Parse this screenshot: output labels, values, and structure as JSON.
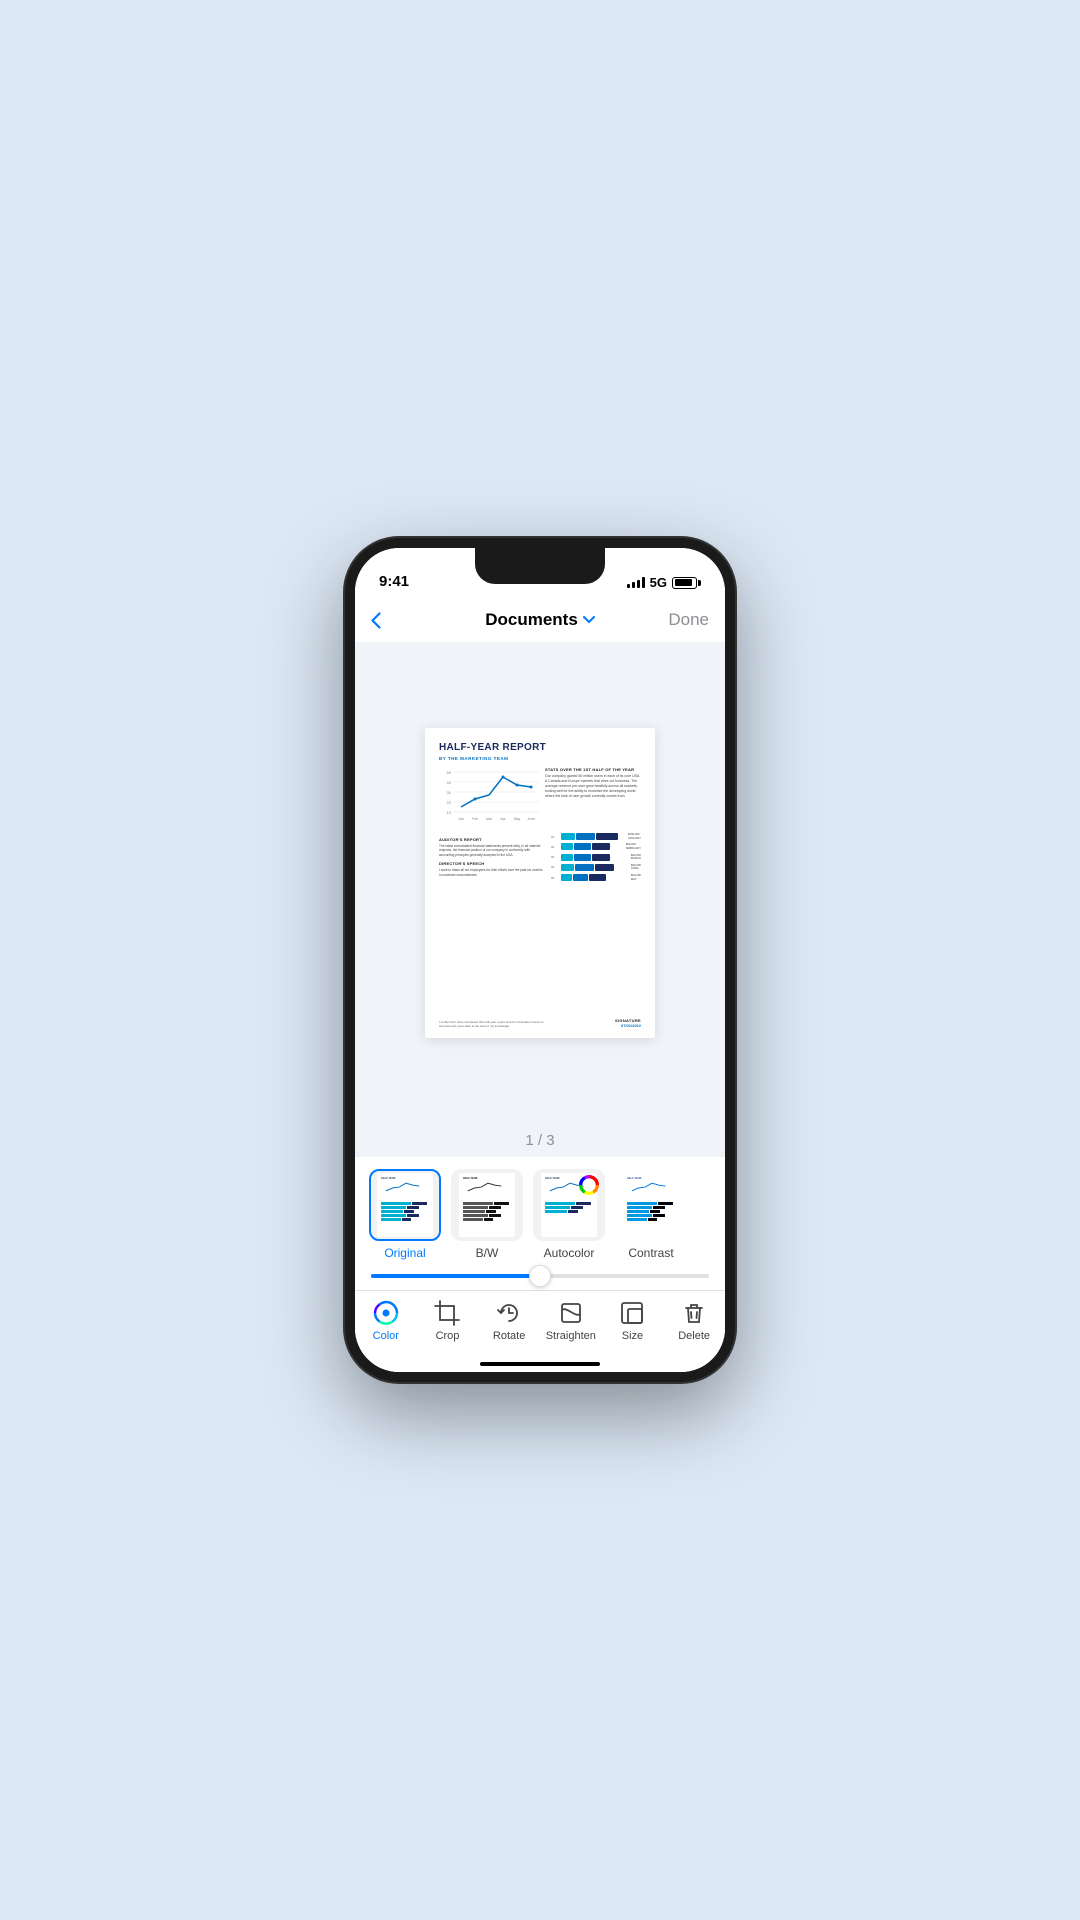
{
  "statusBar": {
    "time": "9:41",
    "network": "5G"
  },
  "navBar": {
    "backLabel": "‹",
    "title": "Documents",
    "chevron": "▾",
    "doneLabel": "Done"
  },
  "document": {
    "title": "HALF-YEAR REPORT",
    "subtitle": "BY THE MARKETING TEAM",
    "statsTitle": "STATS OVER THE 1ST HALF OF THE YEAR",
    "statsText": "Our company gained 50 million users in each of its core USA & Canada and Europe markets that drive our business. The average revenue per user grew healthily across all markets, boding well for the ability to monetize the developing world where the bulk of user growth currently comes from.",
    "auditorTitle": "AUDITOR'S REPORT",
    "auditorText": "The latest consolidated financial statements present fairly, in all material respects, the financial position of our company in conformity with accounting principles generally accepted in the USA.",
    "directorTitle": "DIRECTOR'S SPEECH",
    "directorText": "I want to thank all our employees for their efforts over the past six months in uncertain circumstances.",
    "certText": "I certify that I have completed this half-year report and the infromation herein is accurate and up-to-date to the best of my knowledge.",
    "signatureLabel": "SIGNATURE",
    "signatureDate": "07/01/2022",
    "barData": [
      {
        "label": "01",
        "val1": 20,
        "val2": 30,
        "val3": 35,
        "value": "$100,000\nJANUARY"
      },
      {
        "label": "02",
        "val1": 18,
        "val2": 28,
        "val3": 30,
        "value": "$90,000\nFEBRUARY"
      },
      {
        "label": "03",
        "val1": 16,
        "val2": 26,
        "val3": 28,
        "value": "$90,000\nMARCH"
      },
      {
        "label": "04",
        "val1": 18,
        "val2": 28,
        "val3": 30,
        "value": "$90,000\nAPRIL"
      },
      {
        "label": "05",
        "val1": 14,
        "val2": 24,
        "val3": 26,
        "value": "$90,000\nMAY"
      }
    ]
  },
  "pageCounter": "1 / 3",
  "filters": [
    {
      "id": "original",
      "label": "Original",
      "selected": true
    },
    {
      "id": "bw",
      "label": "B/W",
      "selected": false
    },
    {
      "id": "autocolor",
      "label": "Autocolor",
      "selected": false
    },
    {
      "id": "contrast",
      "label": "Contrast",
      "selected": false
    }
  ],
  "toolbar": {
    "items": [
      {
        "id": "color",
        "label": "Color",
        "active": true
      },
      {
        "id": "crop",
        "label": "Crop",
        "active": false
      },
      {
        "id": "rotate",
        "label": "Rotate",
        "active": false
      },
      {
        "id": "straighten",
        "label": "Straighten",
        "active": false
      },
      {
        "id": "size",
        "label": "Size",
        "active": false
      },
      {
        "id": "delete",
        "label": "Delete",
        "active": false
      }
    ]
  }
}
